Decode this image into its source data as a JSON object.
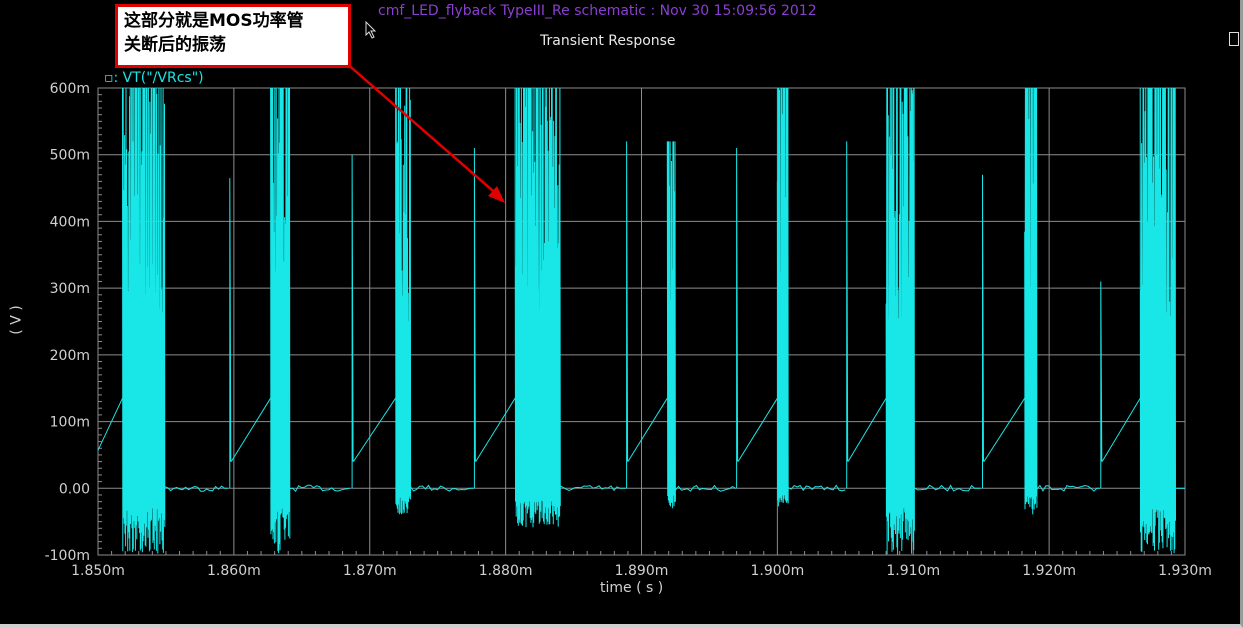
{
  "header": "cmf_LED_flyback TypeIII_Re schematic : Nov 30 15:09:56 2012",
  "annotation": {
    "line1": "这部分就是MOS功率管",
    "line2": "关断后的振荡"
  },
  "colors": {
    "trace": "#19e6e6",
    "grid": "#8c8c8c",
    "header": "#8a3fd0",
    "arrow": "#e00000"
  },
  "chart_data": {
    "type": "line",
    "title": "Transient Response",
    "xlabel": "time ( s )",
    "ylabel": "( V )",
    "legend": "▫: VT(\"/VRcs\")",
    "legend_position": "top-left",
    "grid": true,
    "xlim": [
      1.85,
      1.93
    ],
    "ylim": [
      -0.1,
      0.6
    ],
    "x_unit": "ms",
    "x_ticks": [
      "1.850m",
      "1.860m",
      "1.870m",
      "1.880m",
      "1.890m",
      "1.900m",
      "1.910m",
      "1.920m",
      "1.930m"
    ],
    "y_ticks": [
      "-100m",
      "0.00",
      "100m",
      "200m",
      "300m",
      "400m",
      "500m",
      "600m"
    ],
    "initial_value": 0.057,
    "ramp_end_value": 0.135,
    "bursts": [
      {
        "start": 1.8518,
        "end": 1.8549,
        "max": 0.62,
        "min": -0.1
      },
      {
        "start": 1.8627,
        "end": 1.8641,
        "max": 0.62,
        "min": -0.1
      },
      {
        "start": 1.8719,
        "end": 1.873,
        "max": 0.62,
        "min": -0.04
      },
      {
        "start": 1.8807,
        "end": 1.884,
        "max": 0.62,
        "min": -0.06
      },
      {
        "start": 1.8919,
        "end": 1.8925,
        "max": 0.52,
        "min": -0.03
      },
      {
        "start": 1.9,
        "end": 1.9008,
        "max": 0.62,
        "min": -0.03
      },
      {
        "start": 1.908,
        "end": 1.9101,
        "max": 0.62,
        "min": -0.1
      },
      {
        "start": 1.9182,
        "end": 1.9191,
        "max": 0.62,
        "min": -0.04
      },
      {
        "start": 1.9267,
        "end": 1.9293,
        "max": 0.62,
        "min": -0.1
      }
    ],
    "spikes": [
      {
        "t": 1.8597,
        "peak": 0.465
      },
      {
        "t": 1.8687,
        "peak": 0.5
      },
      {
        "t": 1.8777,
        "peak": 0.51
      },
      {
        "t": 1.8889,
        "peak": 0.52
      },
      {
        "t": 1.897,
        "peak": 0.51
      },
      {
        "t": 1.9051,
        "peak": 0.52
      },
      {
        "t": 1.9151,
        "peak": 0.47
      },
      {
        "t": 1.9238,
        "peak": 0.31
      }
    ]
  }
}
